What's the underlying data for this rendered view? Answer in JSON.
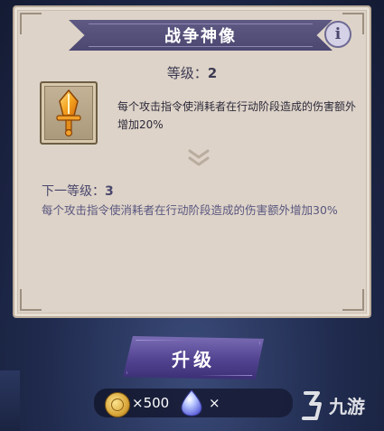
{
  "header": {
    "title": "战争神像",
    "info_icon": "info-icon"
  },
  "level": {
    "label": "等级：",
    "value": "2"
  },
  "item": {
    "icon": "sword-icon",
    "description": "每个攻击指令使消耗者在行动阶段造成的伤害额外增加20%"
  },
  "next_level": {
    "label": "下一等级：",
    "value": "3",
    "description": "每个攻击指令使消耗者在行动阶段造成的伤害额外增加30%"
  },
  "actions": {
    "upgrade_label": "升级"
  },
  "cost": {
    "coin_icon": "coin-icon",
    "coin_amount": "×500",
    "crystal_icon": "crystal-icon",
    "crystal_amount": "×"
  },
  "watermark": {
    "text": "九游"
  },
  "colors": {
    "panel": "#ddd3c8",
    "ribbon": "#524d79",
    "accent": "#5e50a0"
  }
}
